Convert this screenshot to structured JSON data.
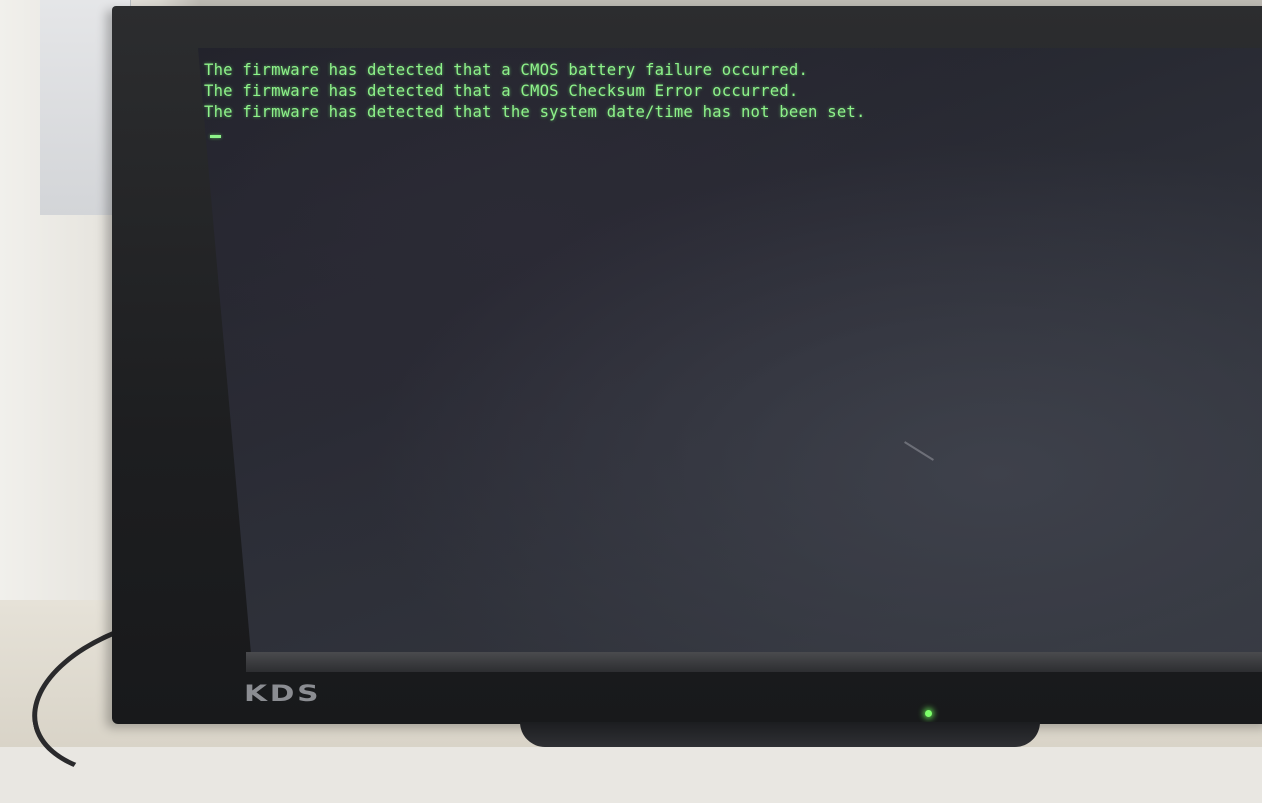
{
  "terminal": {
    "lines": [
      "The firmware has detected that a CMOS battery failure occurred.",
      "The firmware has detected that a CMOS Checksum Error occurred.",
      "The firmware has detected that the system date/time has not been set."
    ],
    "text_color": "#8ef28a"
  },
  "monitor": {
    "brand": "KDS",
    "power_led_color": "#7dff6a"
  }
}
